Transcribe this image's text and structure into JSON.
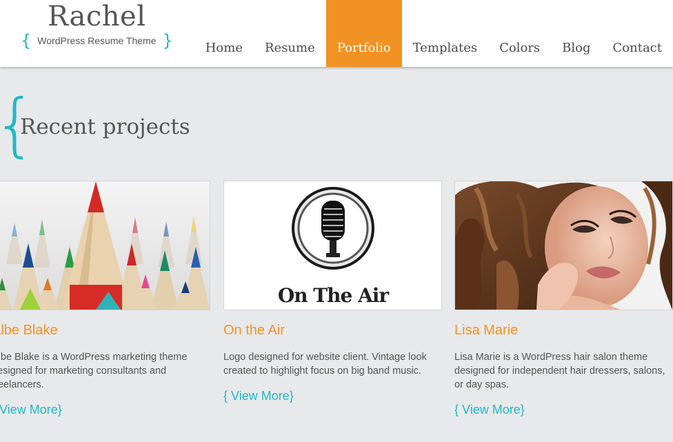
{
  "header": {
    "site_name": "Rachel",
    "tagline": "WordPress Resume Theme",
    "brace_open": "{",
    "brace_close": "}"
  },
  "nav": {
    "items": [
      {
        "label": "Home"
      },
      {
        "label": "Resume"
      },
      {
        "label": "Portfolio",
        "active": true
      },
      {
        "label": "Templates"
      },
      {
        "label": "Colors"
      },
      {
        "label": "Blog"
      },
      {
        "label": "Contact"
      }
    ]
  },
  "section": {
    "brace": "{",
    "title": "Recent projects"
  },
  "projects": [
    {
      "title": "Albe Blake",
      "description": "Albe Blake is a WordPress marketing theme designed for marketing consultants and freelancers.",
      "link": "{ View More}",
      "thumb_icon": "colored-pencils-image"
    },
    {
      "title": "On the Air",
      "description": "Logo designed for website client. Vintage look created to highlight focus on big band music.",
      "link": "{ View More}",
      "thumb_icon": "microphone-logo-image",
      "logo_text": "On The Air"
    },
    {
      "title": "Lisa Marie",
      "description": "Lisa Marie is a WordPress hair salon theme designed for independent hair dressers, salons, or day spas.",
      "link": "{ View More}",
      "thumb_icon": "woman-portrait-image"
    }
  ],
  "colors": {
    "accent_orange": "#f29223",
    "accent_teal": "#1fb9c6",
    "background": "#e8e9eb"
  }
}
